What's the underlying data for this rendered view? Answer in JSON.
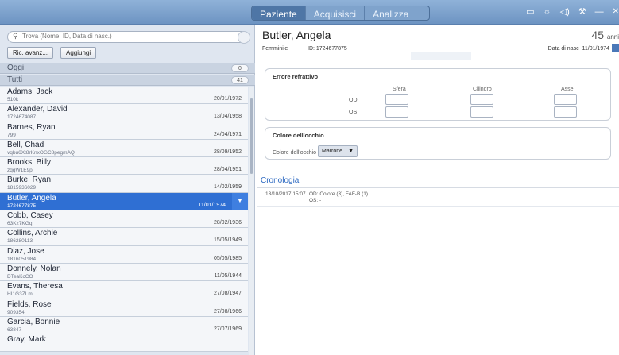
{
  "topbar": {
    "tabs": [
      "Paziente",
      "Acquisisci",
      "Analizza"
    ],
    "active_tab": "Paziente",
    "icons": [
      "monitor-icon",
      "brightness-icon",
      "volume-icon",
      "wrench-icon",
      "minimize-icon",
      "close-icon"
    ]
  },
  "sidebar": {
    "search_placeholder": "Trova (Nome, ID, Data di nasc.)",
    "advanced_button": "Ric. avanz...",
    "add_button": "Aggiungi",
    "group_today": {
      "label": "Oggi",
      "count": "0"
    },
    "group_all": {
      "label": "Tutti",
      "count": "41"
    },
    "patients": [
      {
        "name": "Adams, Jack",
        "id": "510k",
        "dob": "20/01/1972"
      },
      {
        "name": "Alexander, David",
        "id": "1724674087",
        "dob": "13/04/1958"
      },
      {
        "name": "Barnes, Ryan",
        "id": "799",
        "dob": "24/04/1971"
      },
      {
        "name": "Bell, Chad",
        "id": "vqbu6Xt8rKnxOGC8pegmAQ",
        "dob": "28/09/1952"
      },
      {
        "name": "Brooks, Billy",
        "id": "zqqW1E9p",
        "dob": "28/04/1951"
      },
      {
        "name": "Burke, Ryan",
        "id": "1815936029",
        "dob": "14/02/1959"
      },
      {
        "name": "Butler, Angela",
        "id": "1724677875",
        "dob": "11/01/1974"
      },
      {
        "name": "Cobb, Casey",
        "id": "63Kz7KGq",
        "dob": "28/02/1936"
      },
      {
        "name": "Collins, Archie",
        "id": "186280113",
        "dob": "15/05/1949"
      },
      {
        "name": "Diaz, Jose",
        "id": "1816051984",
        "dob": "05/05/1985"
      },
      {
        "name": "Donnely, Nolan",
        "id": "DTeaKcCO",
        "dob": "11/05/1944"
      },
      {
        "name": "Evans, Theresa",
        "id": "HI1G3ZLm",
        "dob": "27/08/1947"
      },
      {
        "name": "Fields, Rose",
        "id": "909354",
        "dob": "27/08/1966"
      },
      {
        "name": "Garcia, Bonnie",
        "id": "63847",
        "dob": "27/07/1969"
      },
      {
        "name": "Gray, Mark",
        "id": "",
        "dob": ""
      }
    ],
    "selected_index": 6
  },
  "patient": {
    "name": "Butler, Angela",
    "age": "45",
    "age_unit": "anni",
    "gender": "Femminile",
    "id_label": "ID: 1724677875",
    "dob_label": "Data di nasc",
    "dob": "11/01/1974"
  },
  "refraction": {
    "title": "Errore refrattivo",
    "columns": [
      "Sfera",
      "Cilindro",
      "Asse"
    ],
    "rows": [
      "OD",
      "OS"
    ]
  },
  "eye_color": {
    "title": "Colore dell'occhio",
    "label": "Colore dell'occhio",
    "value": "Marrone"
  },
  "history": {
    "title": "Cronologia",
    "entries": [
      {
        "date": "13/10/2017 15:07",
        "od": "OD: Colore (3), FAF-B (1)",
        "os": "OS: -"
      }
    ]
  }
}
